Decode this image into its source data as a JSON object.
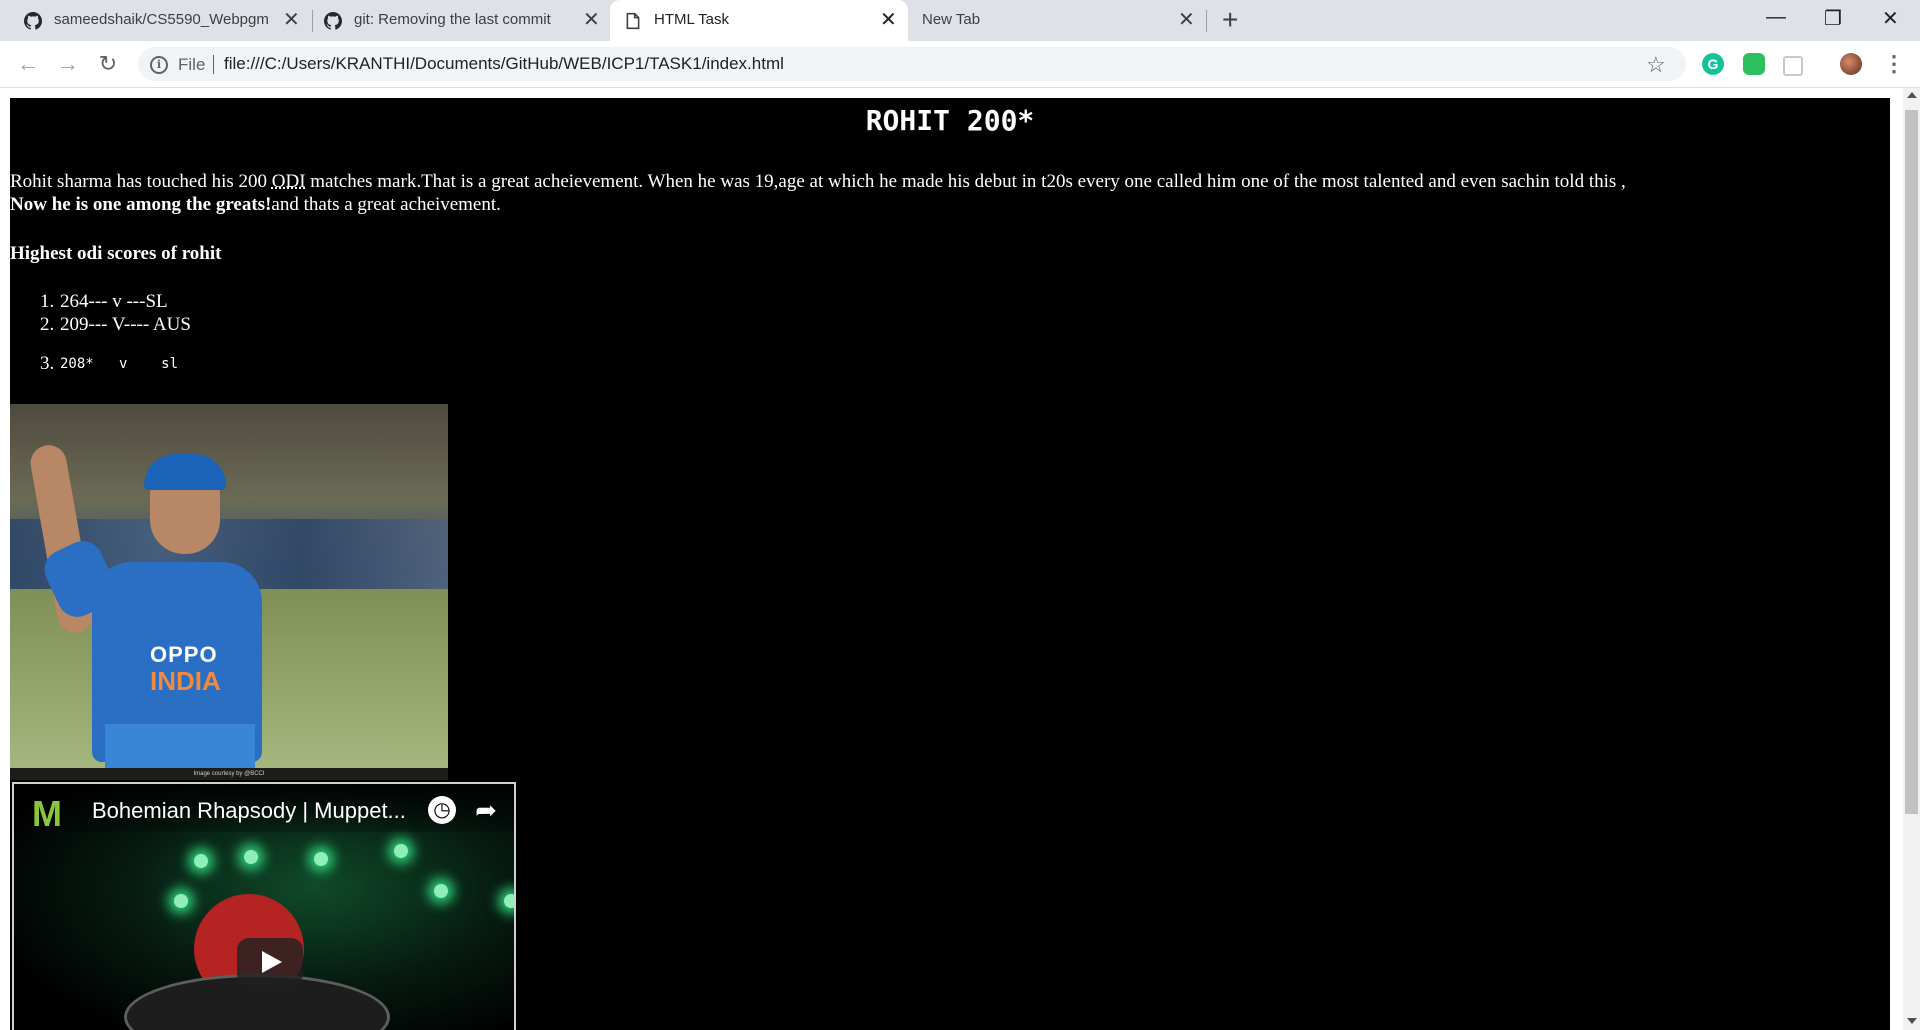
{
  "browser": {
    "tabs": [
      {
        "title": "sameedshaik/CS5590_Webpgm",
        "icon": "github-icon"
      },
      {
        "title": "git: Removing the last commit",
        "icon": "github-icon"
      },
      {
        "title": "HTML Task",
        "icon": "page-icon",
        "active": true
      },
      {
        "title": "New Tab",
        "icon": ""
      }
    ],
    "new_tab_label": "+",
    "address": {
      "scheme_label": "File",
      "url": "file:///C:/Users/KRANTHI/Documents/GitHub/WEB/ICP1/TASK1/index.html"
    },
    "window_controls": {
      "minimize": "—",
      "restore": "❐",
      "close": "✕"
    }
  },
  "page": {
    "heading": "ROHIT 200*",
    "intro_before_abbr": "Rohit sharma has touched his 200 ",
    "intro_abbr": "ODI",
    "intro_after_abbr": " matches mark.That is a great acheievement. When he was 19,age at which he made his debut in t20s every one called him one of the most talented and even sachin told this ,",
    "intro_bold": "Now he is one among the greats!",
    "intro_tail": "and thats a great acheivement.",
    "scores_heading": "Highest odi scores of rohit",
    "scores": [
      {
        "num": "1.",
        "text": "264--- v ---SL"
      },
      {
        "num": "2.",
        "text": "209--- V---- AUS"
      },
      {
        "num": "3.",
        "text": "208*   v    sl"
      }
    ],
    "photo": {
      "jersey_brand": "OPPO",
      "jersey_country": "INDIA",
      "credit": "Image courtesy by @BCCI"
    },
    "video": {
      "channel_logo": "M",
      "title": "Bohemian Rhapsody | Muppet..."
    }
  },
  "colors": {
    "page_background": "#000000",
    "page_text": "#ffffff",
    "tabstrip": "#dee1e6",
    "grammarly": "#15c39a",
    "evernote": "#2dbe60"
  }
}
